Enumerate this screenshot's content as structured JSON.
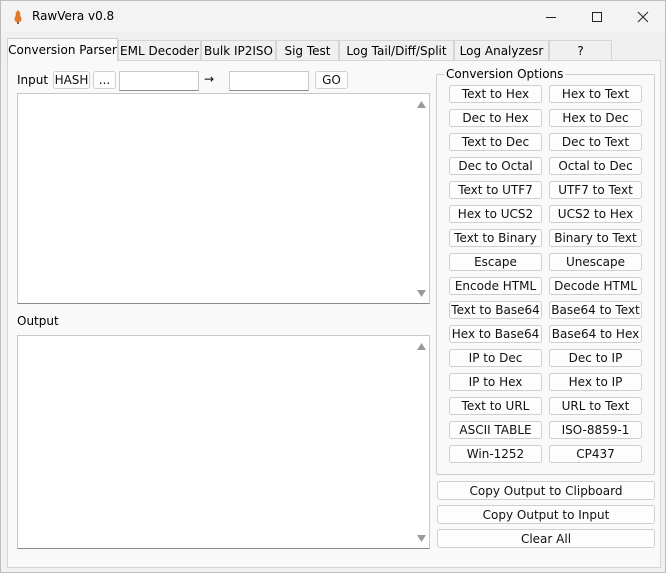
{
  "window": {
    "title": "RawVera v0.8"
  },
  "window_controls": {
    "minimize": "minimize-icon",
    "maximize": "maximize-icon",
    "close": "close-icon"
  },
  "tabs": [
    {
      "label": "Conversion Parser",
      "active": true
    },
    {
      "label": "EML Decoder"
    },
    {
      "label": "Bulk IP2ISO"
    },
    {
      "label": "Sig Test"
    },
    {
      "label": "Log Tail/Diff/Split"
    },
    {
      "label": "Log Analyzesr"
    },
    {
      "label": "?"
    }
  ],
  "input_row": {
    "label": "Input",
    "hash_button": "HASH",
    "browse_button": "...",
    "field1_value": "",
    "arrow": "→",
    "field2_value": "",
    "go_button": "GO"
  },
  "output": {
    "label": "Output"
  },
  "conversion_options": {
    "title": "Conversion Options",
    "buttons": [
      [
        "Text to Hex",
        "Hex to Text"
      ],
      [
        "Dec to Hex",
        "Hex to Dec"
      ],
      [
        "Text to Dec",
        "Dec to Text"
      ],
      [
        "Dec to Octal",
        "Octal to Dec"
      ],
      [
        "Text to UTF7",
        "UTF7 to Text"
      ],
      [
        "Hex to UCS2",
        "UCS2 to Hex"
      ],
      [
        "Text to Binary",
        "Binary to Text"
      ],
      [
        "Escape",
        "Unescape"
      ],
      [
        "Encode HTML",
        "Decode HTML"
      ],
      [
        "Text to Base64",
        "Base64 to Text"
      ],
      [
        "Hex to Base64",
        "Base64 to Hex"
      ],
      [
        "IP to Dec",
        "Dec to IP"
      ],
      [
        "IP to Hex",
        "Hex to IP"
      ],
      [
        "Text to URL",
        "URL to Text"
      ],
      [
        "ASCII TABLE",
        "ISO-8859-1"
      ],
      [
        "Win-1252",
        "CP437"
      ]
    ]
  },
  "actions": {
    "copy_to_clipboard": "Copy Output to Clipboard",
    "copy_to_input": "Copy Output to Input",
    "clear_all": "Clear All"
  }
}
